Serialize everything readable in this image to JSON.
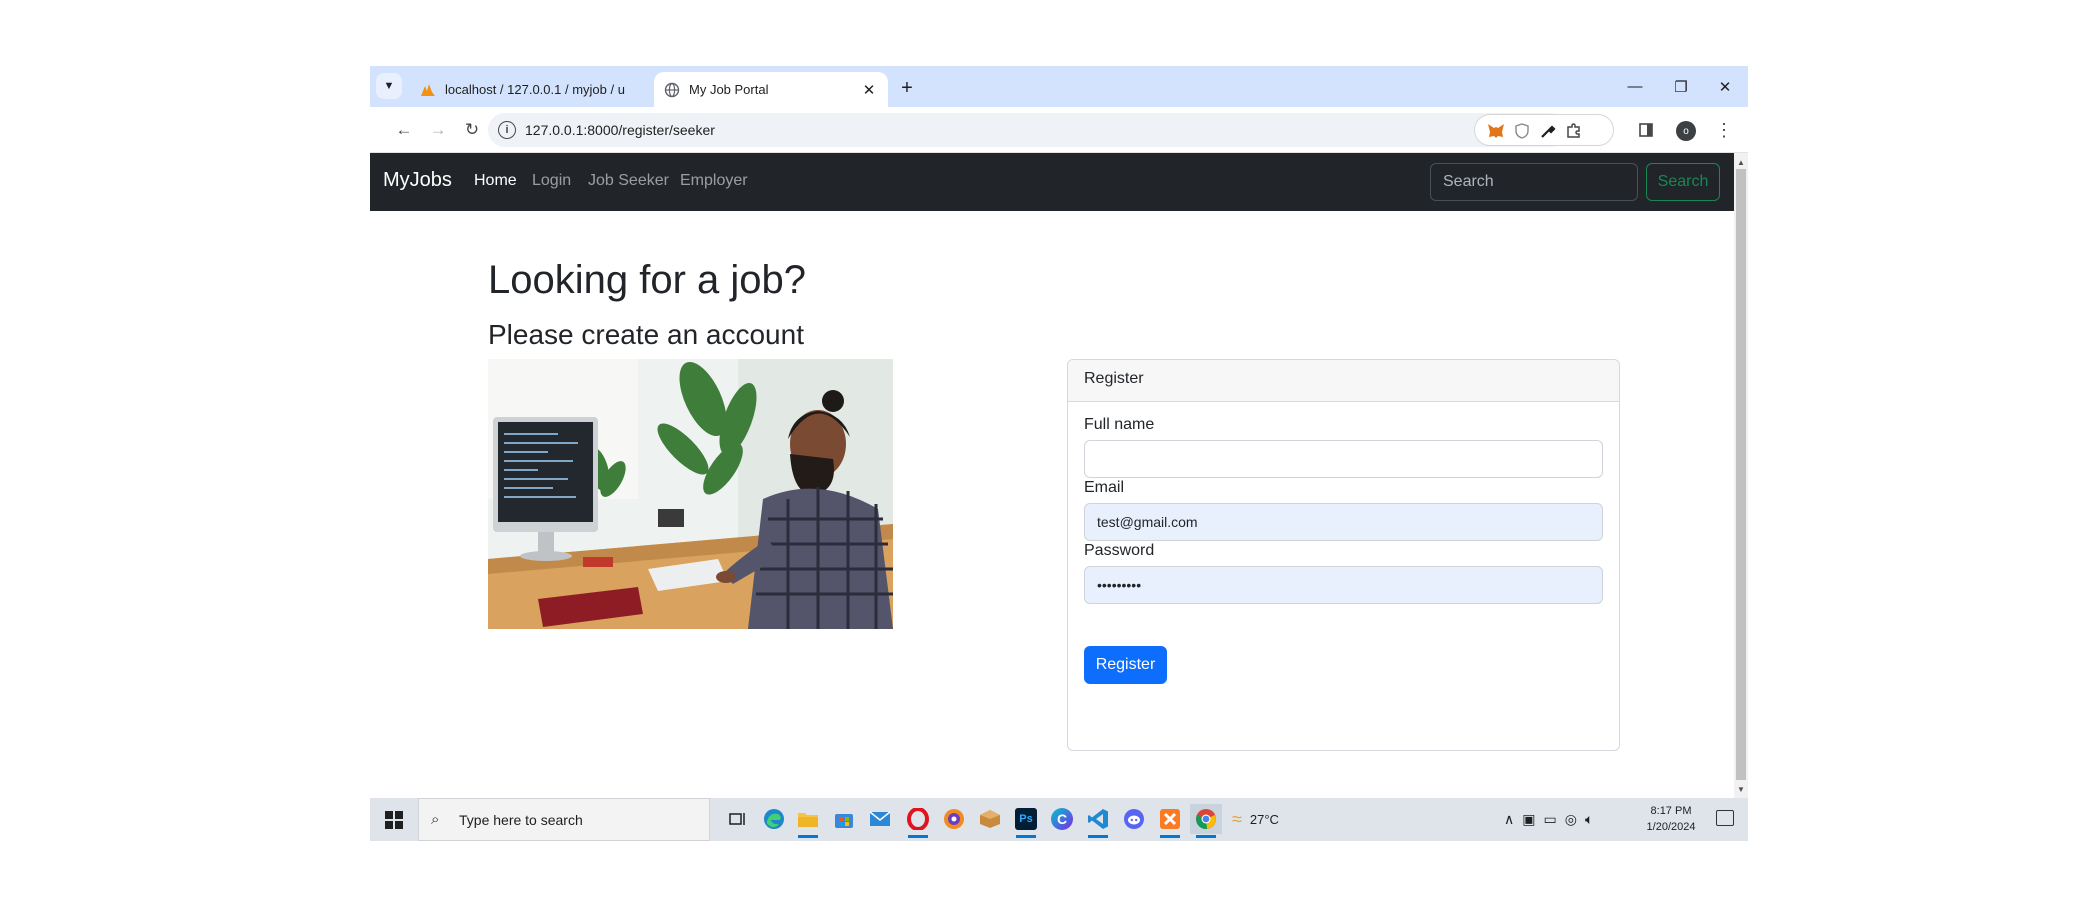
{
  "browser": {
    "tabs": [
      {
        "title": "localhost / 127.0.0.1 / myjob / u",
        "active": false
      },
      {
        "title": "My Job Portal",
        "active": true
      }
    ],
    "url": "127.0.0.1:8000/register/seeker"
  },
  "navbar": {
    "brand": "MyJobs",
    "links": [
      "Home",
      "Login",
      "Job Seeker",
      "Employer"
    ],
    "search_placeholder": "Search",
    "search_button": "Search"
  },
  "page": {
    "heading": "Looking for a job?",
    "subheading": "Please create an account"
  },
  "form": {
    "header": "Register",
    "fullname_label": "Full name",
    "fullname_value": "",
    "email_label": "Email",
    "email_value": "test@gmail.com",
    "password_label": "Password",
    "password_value": "•••••••••",
    "submit_label": "Register"
  },
  "taskbar": {
    "search_placeholder": "Type here to search",
    "weather": "27°C",
    "time": "8:17 PM",
    "date": "1/20/2024"
  },
  "colors": {
    "navbar_bg": "#212529",
    "primary": "#0d6efd",
    "success": "#198754",
    "tabstrip": "#d3e3fd"
  }
}
